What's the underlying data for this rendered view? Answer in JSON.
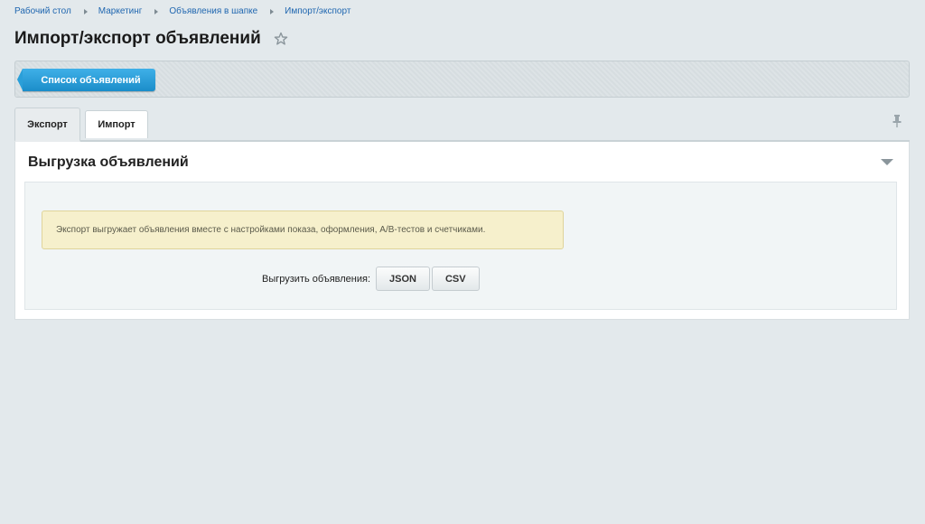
{
  "breadcrumb": [
    "Рабочий стол",
    "Маркетинг",
    "Объявления в шапке",
    "Импорт/экспорт"
  ],
  "page_title": "Импорт/экспорт объявлений",
  "toolbar": {
    "list_button": "Список объявлений"
  },
  "tabs": [
    {
      "label": "Экспорт",
      "active": true
    },
    {
      "label": "Импорт",
      "active": false
    }
  ],
  "panel": {
    "heading": "Выгрузка объявлений",
    "notice": "Экспорт выгружает объявления вместе с настройками показа, оформления, A/B-тестов и счетчиками.",
    "export_label": "Выгрузить объявления:",
    "buttons": [
      "JSON",
      "CSV"
    ]
  },
  "icons": {
    "star": "star-icon",
    "pin": "pin-icon",
    "collapse": "chevron-down-icon",
    "breadcrumb_separator": "chevron-right-icon"
  },
  "colors": {
    "page_bg": "#e3e9ec",
    "link": "#2067b0",
    "primary_button": "#1b8dc9",
    "notice_bg": "#f6f0cc"
  }
}
